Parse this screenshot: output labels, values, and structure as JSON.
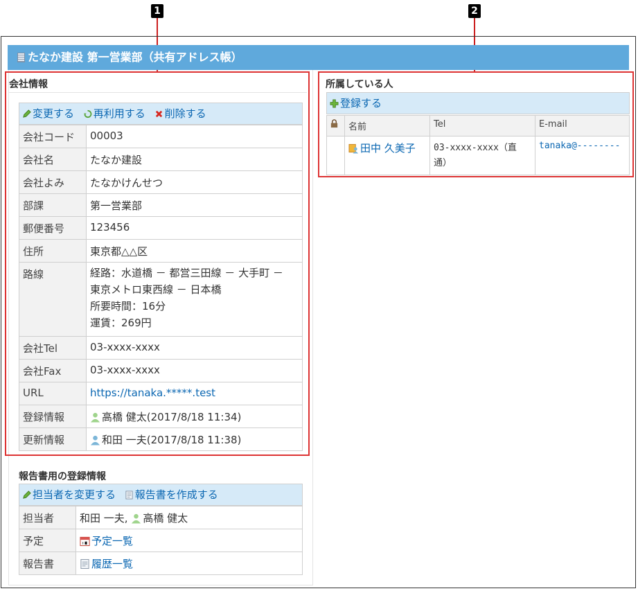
{
  "callouts": {
    "one": "1",
    "two": "2"
  },
  "title": "たなか建設 第一営業部（共有アドレス帳）",
  "company": {
    "section_title": "会社情報",
    "actions": {
      "edit": "変更する",
      "reuse": "再利用する",
      "delete": "削除する"
    },
    "rows": [
      {
        "label": "会社コード",
        "value": "00003"
      },
      {
        "label": "会社名",
        "value": "たなか建設"
      },
      {
        "label": "会社よみ",
        "value": "たなかけんせつ"
      },
      {
        "label": "部課",
        "value": "第一営業部"
      },
      {
        "label": "郵便番号",
        "value": "123456"
      },
      {
        "label": "住所",
        "value": "東京都△△区"
      },
      {
        "label": "路線",
        "lines": [
          "経路：水道橋 － 都営三田線 － 大手町 －",
          "東京メトロ東西線 － 日本橋",
          "所要時間：16分",
          "運賃：269円"
        ]
      },
      {
        "label": "会社Tel",
        "value": "03-xxxx-xxxx"
      },
      {
        "label": "会社Fax",
        "value": "03-xxxx-xxxx"
      },
      {
        "label": "URL",
        "value": "https://tanaka.*****.test"
      },
      {
        "label": "登録情報",
        "value": "高橋 健太(2017/8/18 11:34)"
      },
      {
        "label": "更新情報",
        "value": "和田 一夫(2017/8/18 11:38)"
      }
    ]
  },
  "report": {
    "section_title": "報告書用の登録情報",
    "actions": {
      "change_person": "担当者を変更する",
      "create_report": "報告書を作成する"
    },
    "rows": [
      {
        "label": "担当者",
        "value_a": "和田 一夫,",
        "value_b": "高橋 健太"
      },
      {
        "label": "予定",
        "value": "予定一覧"
      },
      {
        "label": "報告書",
        "value": "履歴一覧"
      }
    ]
  },
  "members": {
    "section_title": "所属している人",
    "register": "登録する",
    "headers": {
      "name": "名前",
      "tel": "Tel",
      "email": "E-mail"
    },
    "rows": [
      {
        "name": "田中 久美子",
        "tel_1": "03-xxxx-xxxx（直",
        "tel_2": "通）",
        "email": "tanaka@--------"
      }
    ]
  },
  "colors": {
    "title_bar": "#5fa9dc",
    "toolbar": "#d6eaf8",
    "callout_box": "#d33333",
    "link": "#0b67b2"
  }
}
